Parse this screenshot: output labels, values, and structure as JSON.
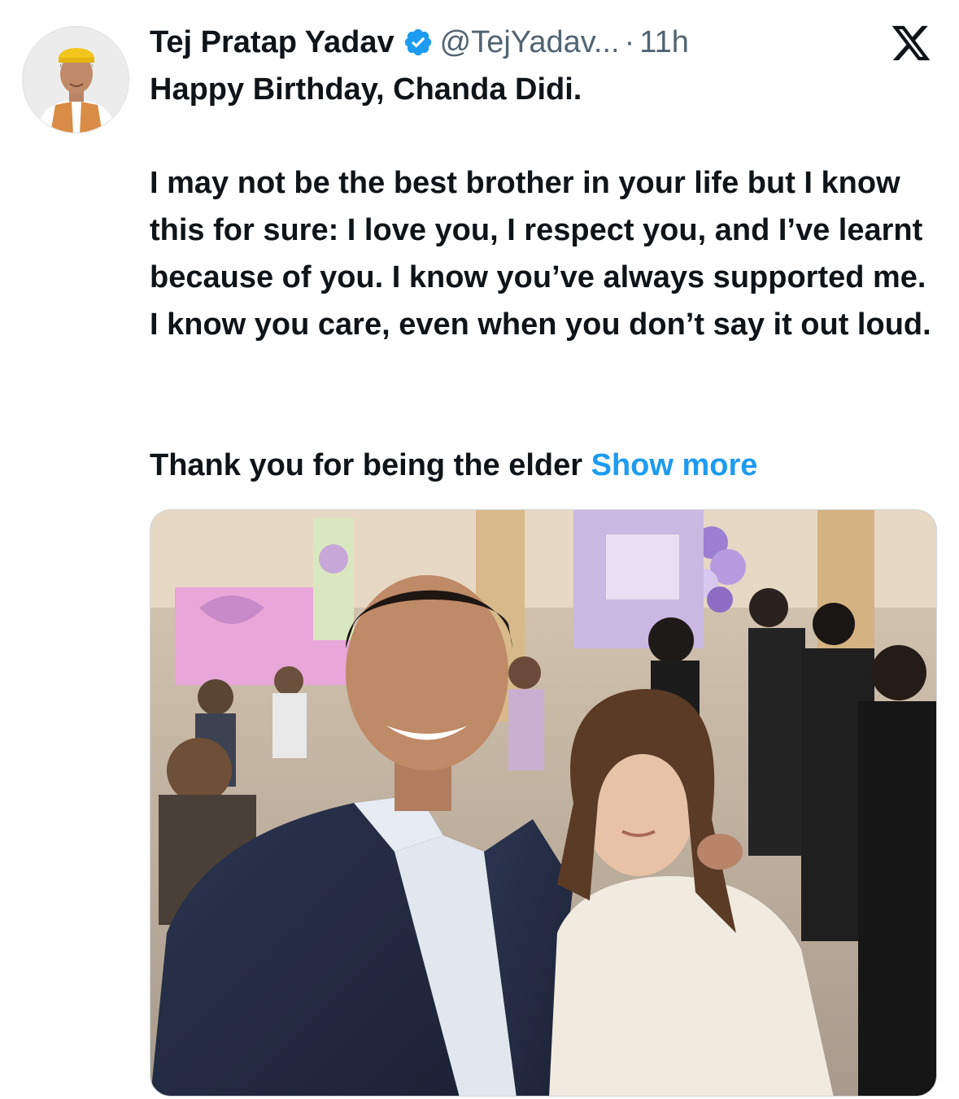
{
  "tweet": {
    "author": {
      "display_name": "Tej Pratap Yadav",
      "handle": "@TejYadav...",
      "avatar_icon": "profile-photo",
      "verified_icon": "verified-badge-icon"
    },
    "separator": "·",
    "time": "11h",
    "platform_icon": "x-logo-icon",
    "text": {
      "line1": "Happy Birthday, Chanda Didi.",
      "para2": "I may not be the best brother in your life but I know this for sure: I love you, I respect you, and I’ve learnt because of you. I know you’ve always supported me. I know you care, even when you don’t say it out loud.",
      "para3": "Thank you for being the elder",
      "show_more": "Show more"
    },
    "media": {
      "type": "photo",
      "icon": "selfie-photo"
    }
  },
  "colors": {
    "text_primary": "#0f1419",
    "text_secondary": "#536471",
    "link": "#1d9bf0",
    "verified": "#1d9bf0"
  }
}
